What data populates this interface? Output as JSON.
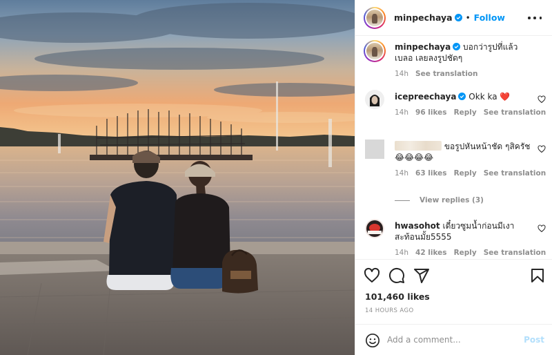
{
  "post": {
    "author": "minpechaya",
    "follow_label": "Follow",
    "separator": "•",
    "icons": {
      "verified": "verified-badge-icon",
      "more": "more-options-icon",
      "like": "heart-icon",
      "comment": "comment-icon",
      "share": "share-icon",
      "save": "bookmark-icon",
      "emoji": "emoji-icon"
    },
    "colors": {
      "accent": "#0095f6",
      "text": "#262626",
      "secondary": "#8e8e8e",
      "like_red": "#ed4956"
    }
  },
  "caption": {
    "username": "minpechaya",
    "text": "บอกว่ารูปที่แล้วเบลอ เลยลงรูปชัดๆ",
    "time": "14h",
    "see_translation": "See translation"
  },
  "comments": [
    {
      "username": "icepreechaya",
      "text": "Okk ka",
      "emoji": "❤️",
      "time": "14h",
      "likes": "96 likes",
      "reply": "Reply",
      "see_translation": "See translation"
    },
    {
      "username": "",
      "text": "ขอรูปหันหน้าชัด ๆสิครัช",
      "emoji": "😂😂😂😂",
      "time": "14h",
      "likes": "63 likes",
      "reply": "Reply",
      "see_translation": "See translation"
    },
    {
      "username": "hwasohot",
      "text": "เดี๋ยวซูมน้ำก่อนมีเงาสะท้อนมั้ย5555",
      "time": "14h",
      "likes": "42 likes",
      "reply": "Reply",
      "see_translation": "See translation"
    }
  ],
  "view_replies": "View replies (3)",
  "stats": {
    "likes": "101,460 likes",
    "time": "14 HOURS AGO"
  },
  "composer": {
    "placeholder": "Add a comment...",
    "post_label": "Post"
  }
}
